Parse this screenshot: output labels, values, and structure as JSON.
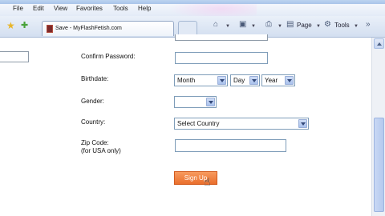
{
  "menu": [
    "File",
    "Edit",
    "View",
    "Favorites",
    "Tools",
    "Help"
  ],
  "tab": {
    "title": "Save - MyFlashFetish.com"
  },
  "toolbar": {
    "page_label": "Page",
    "tools_label": "Tools"
  },
  "form": {
    "confirm_password_label": "Confirm Password:",
    "birthdate_label": "Birthdate:",
    "month_value": "Month",
    "day_value": "Day",
    "year_value": "Year",
    "gender_label": "Gender:",
    "gender_value": "",
    "country_label": "Country:",
    "country_value": "Select Country",
    "zip_label": "Zip Code:",
    "zip_note": "(for USA only)",
    "signup_label": "Sign Up"
  },
  "icons": {
    "favorites": "star-icon",
    "add_favorite": "add-favorite-icon",
    "home": "home-icon",
    "feeds": "feeds-icon",
    "print": "print-icon",
    "cursor": "mouse-pointer-icon"
  },
  "colors": {
    "signup_button": "#ea6f2d",
    "select_arrow": "#a9c1ed",
    "input_border": "#7f9db9"
  }
}
